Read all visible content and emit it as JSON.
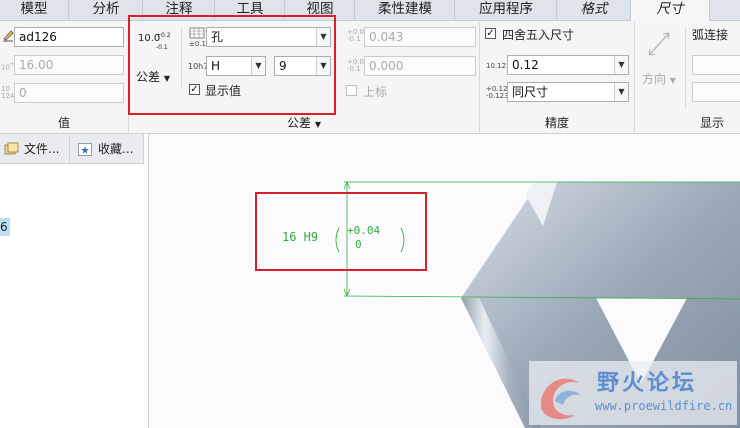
{
  "tabs": [
    "模型",
    "分析",
    "注释",
    "工具",
    "视图",
    "柔性建模",
    "应用程序",
    "格式",
    "尺寸"
  ],
  "value_group": {
    "title": "值",
    "name_value": "ad126",
    "nominal_value": "16.00",
    "decimals_value": "0"
  },
  "tolerance_group": {
    "title": "公差",
    "tolerance_button": "公差",
    "hole_shaft_value": "孔",
    "fit_letter_value": "H",
    "fit_grade_value": "9",
    "show_value_label": "显示值",
    "icon_tol_text": {
      "main": "10.0",
      "upper": "+0.2",
      "lower": "-0.1"
    },
    "icon_hole_text": "±0.1",
    "icon_fit_text": "10h7"
  },
  "limits": {
    "upper_value": "0.043",
    "lower_value": "0.000",
    "upper_label": "上标",
    "icon_upper": {
      "upper": "+0.0",
      "lower": "-0.1"
    },
    "icon_lower": {
      "upper": "+0.0",
      "lower": "-0.1"
    }
  },
  "precision_group": {
    "title": "精度",
    "round_label": "四舍五入尺寸",
    "decimal_value": "0.12",
    "tolerance_precision_value": "同尺寸",
    "icon_decimal": "10.123",
    "icon_tol_precision": {
      "upper": "+0.123",
      "lower": "-0.123"
    }
  },
  "direction": {
    "label": "方向"
  },
  "arc": {
    "label": "弧连接"
  },
  "display_group": {
    "title": "显示"
  },
  "left_panel": {
    "tab_files": "文件...",
    "tab_favorites": "收藏...",
    "tree_item_fragment": "6"
  },
  "canvas": {
    "dim_nominal": "16 H9",
    "dim_upper": "+0.04",
    "dim_lower": "0"
  },
  "watermark": {
    "title": "野火论坛",
    "url": "www.proewildfire.cn"
  },
  "colors": {
    "highlight_red": "#d8202a",
    "dimension_green": "#2fae3e",
    "model_steel": "#9aa8b7"
  }
}
